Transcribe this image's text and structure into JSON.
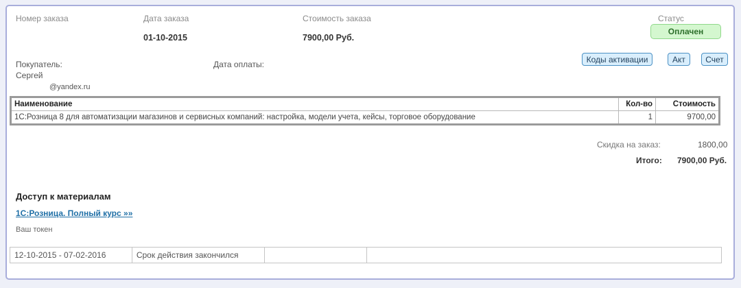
{
  "order": {
    "number_label": "Номер заказа",
    "number_value": "",
    "date_label": "Дата заказа",
    "date_value": "01-10-2015",
    "cost_label": "Стоимость заказа",
    "cost_value": "7900,00 Руб.",
    "status_label": "Статус",
    "status_value": "Оплачен",
    "status_color": "#d4f7cf"
  },
  "buyer": {
    "label": "Покупатель:",
    "name": "Сергей",
    "email": "@yandex.ru",
    "payment_date_label": "Дата оплаты:",
    "payment_date_value": ""
  },
  "actions": {
    "activation_codes": "Коды активации",
    "act": "Акт",
    "invoice": "Счет",
    "accent_color": "#4a90c4"
  },
  "items_table": {
    "headers": {
      "name": "Наименование",
      "qty": "Кол-во",
      "cost": "Стоимость"
    },
    "rows": [
      {
        "name": "1С:Розница 8 для автоматизации магазинов и сервисных компаний: настройка, модели учета, кейсы, торговое оборудование",
        "qty": "1",
        "cost": "9700,00"
      }
    ]
  },
  "totals": {
    "discount_label": "Скидка на заказ:",
    "discount_value": "1800,00",
    "total_label": "Итого:",
    "total_value": "7900,00 Руб."
  },
  "materials": {
    "title": "Доступ к материалам",
    "course_link": "1С:Розница. Полный курс »»",
    "token_label": "Ваш токен",
    "access_row": {
      "period": "12-10-2015 - 07-02-2016",
      "status": "Срок действия закончился",
      "col3": "",
      "col4": ""
    }
  }
}
